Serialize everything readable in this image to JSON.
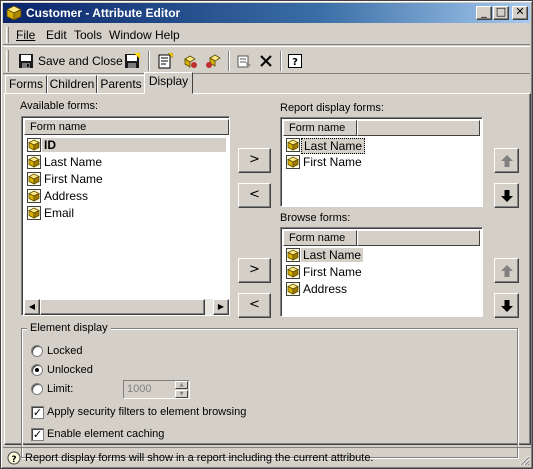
{
  "window": {
    "title": "Customer - Attribute Editor"
  },
  "menu": [
    {
      "label": "File"
    },
    {
      "label": "Edit"
    },
    {
      "label": "Tools"
    },
    {
      "label": "Window"
    },
    {
      "label": "Help"
    }
  ],
  "toolbar": {
    "save_close_label": "Save and Close",
    "icons": [
      "save-and-close-icon",
      "save-icon",
      "new-form-icon",
      "cut-icon",
      "paste-icon",
      "properties-icon",
      "delete-icon",
      "help-icon"
    ]
  },
  "tabs": [
    {
      "label": "Forms"
    },
    {
      "label": "Children"
    },
    {
      "label": "Parents"
    },
    {
      "label": "Display",
      "active": true
    }
  ],
  "available_forms": {
    "label": "Available forms:",
    "column": "Form name",
    "items": [
      {
        "name": "ID",
        "bold": true,
        "selected": true
      },
      {
        "name": "Last Name"
      },
      {
        "name": "First Name"
      },
      {
        "name": "Address"
      },
      {
        "name": "Email"
      }
    ]
  },
  "report_display_forms": {
    "label": "Report display forms:",
    "column": "Form name",
    "items": [
      {
        "name": "Last Name",
        "selected": true
      },
      {
        "name": "First Name"
      }
    ]
  },
  "browse_forms": {
    "label": "Browse forms:",
    "column": "Form name",
    "items": [
      {
        "name": "Last Name",
        "selected": true
      },
      {
        "name": "First Name"
      },
      {
        "name": "Address"
      }
    ]
  },
  "buttons": {
    "add": ">",
    "remove": "<"
  },
  "element_display": {
    "title": "Element display",
    "options": [
      {
        "label": "Locked",
        "checked": false
      },
      {
        "label": "Unlocked",
        "checked": true
      },
      {
        "label": "Limit:",
        "checked": false
      }
    ],
    "limit_value": "1000",
    "checkboxes": [
      {
        "label": "Apply security filters to element browsing",
        "checked": true
      },
      {
        "label": "Enable element caching",
        "checked": true
      }
    ]
  },
  "status": {
    "text": "Report display forms will show in a report including the current attribute."
  },
  "colors": {
    "titlebar_start": "#0a246a",
    "titlebar_end": "#a6caf0",
    "face": "#d4d0c8"
  }
}
